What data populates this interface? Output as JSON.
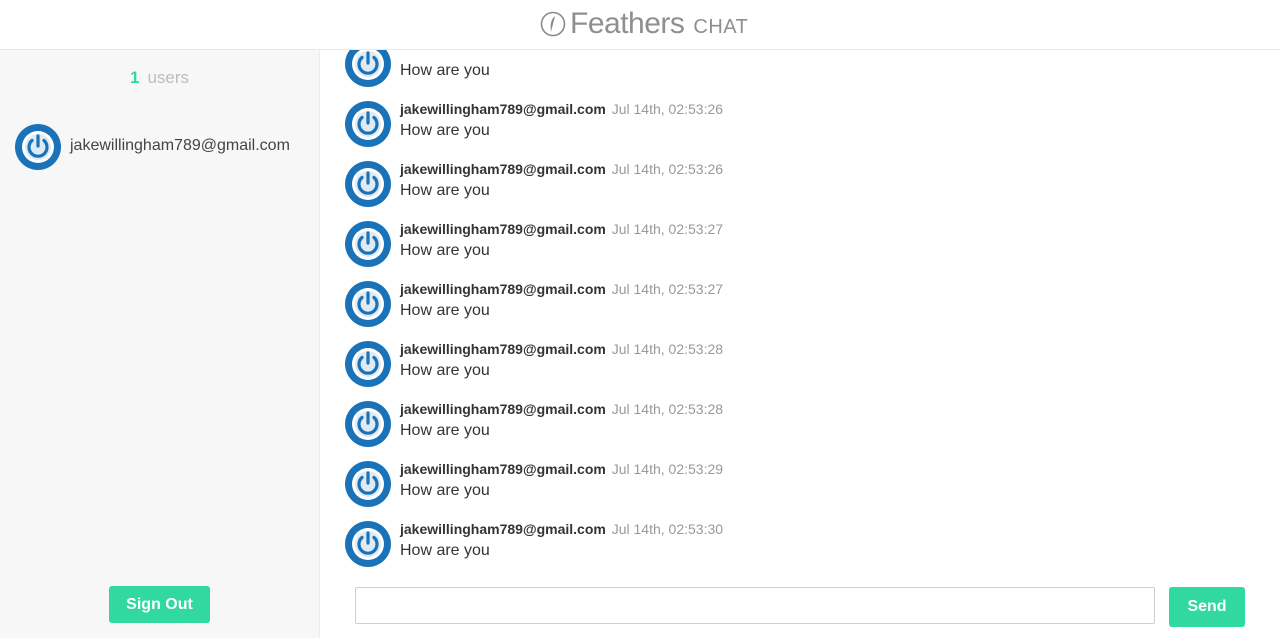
{
  "header": {
    "logo_icon": "feather-icon",
    "logo_name": "Feathers",
    "logo_sub": "CHAT"
  },
  "sidebar": {
    "user_count": "1",
    "user_count_label": "users",
    "users": [
      {
        "email": "jakewillingham789@gmail.com",
        "avatar": "power-avatar-icon"
      }
    ],
    "signout_label": "Sign Out"
  },
  "messages": [
    {
      "author": "",
      "time": "",
      "text": "How are you"
    },
    {
      "author": "jakewillingham789@gmail.com",
      "time": "Jul 14th, 02:53:26",
      "text": "How are you"
    },
    {
      "author": "jakewillingham789@gmail.com",
      "time": "Jul 14th, 02:53:26",
      "text": "How are you"
    },
    {
      "author": "jakewillingham789@gmail.com",
      "time": "Jul 14th, 02:53:27",
      "text": "How are you"
    },
    {
      "author": "jakewillingham789@gmail.com",
      "time": "Jul 14th, 02:53:27",
      "text": "How are you"
    },
    {
      "author": "jakewillingham789@gmail.com",
      "time": "Jul 14th, 02:53:28",
      "text": "How are you"
    },
    {
      "author": "jakewillingham789@gmail.com",
      "time": "Jul 14th, 02:53:28",
      "text": "How are you"
    },
    {
      "author": "jakewillingham789@gmail.com",
      "time": "Jul 14th, 02:53:29",
      "text": "How are you"
    },
    {
      "author": "jakewillingham789@gmail.com",
      "time": "Jul 14th, 02:53:30",
      "text": "How are you"
    }
  ],
  "composer": {
    "input_value": "",
    "input_placeholder": "",
    "send_label": "Send"
  },
  "colors": {
    "accent": "#31d8a0",
    "avatar_blue": "#1a73b8"
  }
}
